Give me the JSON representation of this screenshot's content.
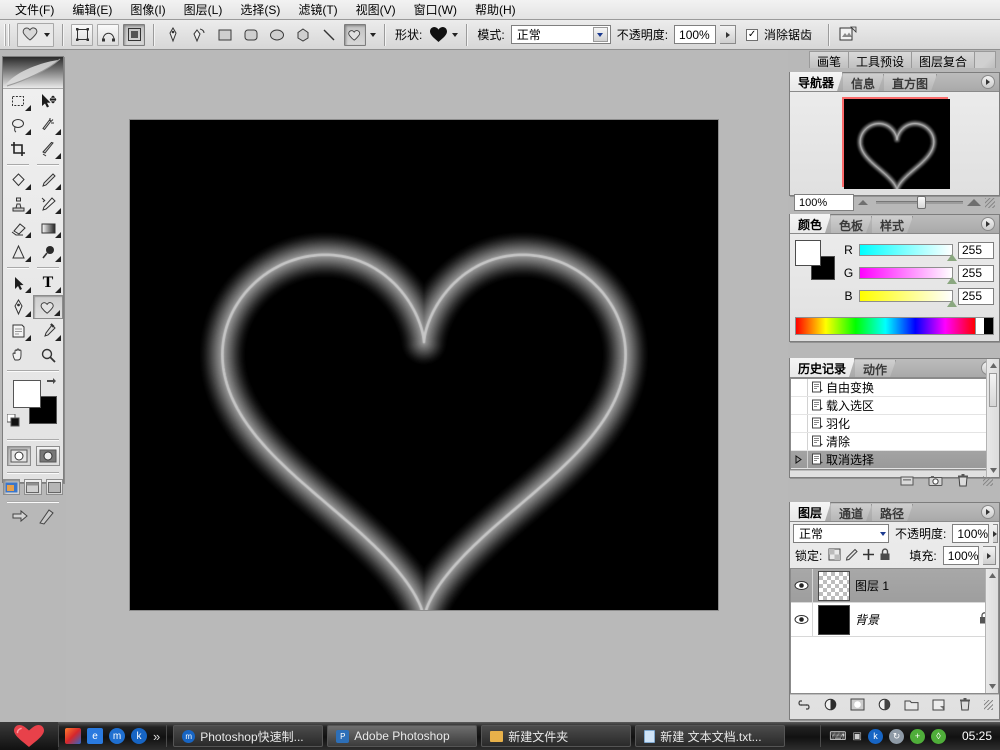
{
  "app": {
    "title": "Adobe Photoshop"
  },
  "menubar": {
    "items": [
      {
        "label": "文件(F)",
        "name": "menu-file"
      },
      {
        "label": "编辑(E)",
        "name": "menu-edit"
      },
      {
        "label": "图像(I)",
        "name": "menu-image"
      },
      {
        "label": "图层(L)",
        "name": "menu-layer"
      },
      {
        "label": "选择(S)",
        "name": "menu-select"
      },
      {
        "label": "滤镜(T)",
        "name": "menu-filter"
      },
      {
        "label": "视图(V)",
        "name": "menu-view"
      },
      {
        "label": "窗口(W)",
        "name": "menu-window"
      },
      {
        "label": "帮助(H)",
        "name": "menu-help"
      }
    ]
  },
  "options_bar": {
    "shape_label": "形状:",
    "shape_value": "heart-shape",
    "mode_label": "模式:",
    "mode_value": "正常",
    "opacity_label": "不透明度:",
    "opacity_value": "100%",
    "antialias_label": "消除锯齿",
    "antialias_checked": true,
    "shape_mode_buttons": [
      "shape-layers",
      "paths",
      "fill-pixels"
    ],
    "draw_tools": [
      "pen-tool",
      "freeform-pen-tool",
      "rectangle-tool",
      "rounded-rectangle-tool",
      "ellipse-tool",
      "polygon-tool",
      "line-tool",
      "custom-shape-tool"
    ]
  },
  "palette_well": {
    "tabs": [
      "画笔",
      "工具预设",
      "图层复合"
    ]
  },
  "toolbox": {
    "tools": [
      {
        "name": "rectangular-marquee-tool",
        "glyph": "▭"
      },
      {
        "name": "move-tool",
        "glyph": "➤"
      },
      {
        "name": "lasso-tool",
        "glyph": "◯"
      },
      {
        "name": "magic-wand-tool",
        "glyph": "✦"
      },
      {
        "name": "crop-tool",
        "glyph": "⌗"
      },
      {
        "name": "slice-tool",
        "glyph": "✂"
      },
      {
        "name": "healing-brush-tool",
        "glyph": "◇"
      },
      {
        "name": "brush-tool",
        "glyph": "✎"
      },
      {
        "name": "clone-stamp-tool",
        "glyph": "♙"
      },
      {
        "name": "history-brush-tool",
        "glyph": "↯"
      },
      {
        "name": "eraser-tool",
        "glyph": "▱"
      },
      {
        "name": "gradient-tool",
        "glyph": "▣"
      },
      {
        "name": "blur-tool",
        "glyph": "△"
      },
      {
        "name": "dodge-tool",
        "glyph": "●"
      },
      {
        "name": "path-selection-tool",
        "glyph": "▲"
      },
      {
        "name": "type-tool",
        "glyph": "T"
      },
      {
        "name": "pen-tool",
        "glyph": "✒"
      },
      {
        "name": "custom-shape-tool",
        "glyph": "✿"
      },
      {
        "name": "notes-tool",
        "glyph": "▤"
      },
      {
        "name": "eyedropper-tool",
        "glyph": "⌯"
      },
      {
        "name": "hand-tool",
        "glyph": "✋"
      },
      {
        "name": "zoom-tool",
        "glyph": "🔍"
      }
    ],
    "selected_tool": "custom-shape-tool",
    "foreground_color": "#ffffff",
    "background_color": "#000000",
    "quickmask": [
      "standard-mode",
      "quick-mask-mode"
    ],
    "screen_modes": [
      "standard-screen-mode",
      "full-screen-with-menubar",
      "full-screen-mode"
    ],
    "jump_to": "jump-to-imageready"
  },
  "navigator": {
    "tabs": [
      "导航器",
      "信息",
      "直方图"
    ],
    "active_tab": "导航器",
    "zoom_value": "100%"
  },
  "color": {
    "tabs": [
      "颜色",
      "色板",
      "样式"
    ],
    "active_tab": "颜色",
    "channels": [
      {
        "label": "R",
        "value": "255"
      },
      {
        "label": "G",
        "value": "255"
      },
      {
        "label": "B",
        "value": "255"
      }
    ],
    "foreground": "#ffffff",
    "background": "#000000"
  },
  "history": {
    "tabs": [
      "历史记录",
      "动作"
    ],
    "active_tab": "历史记录",
    "items": [
      {
        "label": "自由变换",
        "selected": false
      },
      {
        "label": "载入选区",
        "selected": false
      },
      {
        "label": "羽化",
        "selected": false
      },
      {
        "label": "清除",
        "selected": false
      },
      {
        "label": "取消选择",
        "selected": true
      }
    ],
    "footer_buttons": [
      "new-document-from-state-icon",
      "new-snapshot-icon",
      "delete-state-icon"
    ]
  },
  "layers": {
    "tabs": [
      "图层",
      "通道",
      "路径"
    ],
    "active_tab": "图层",
    "blend_mode": "正常",
    "opacity_label": "不透明度:",
    "opacity_value": "100%",
    "lock_label": "锁定:",
    "lock_icons": [
      "lock-transparent-pixels-icon",
      "lock-image-pixels-icon",
      "lock-position-icon",
      "lock-all-icon"
    ],
    "fill_label": "填充:",
    "fill_value": "100%",
    "items": [
      {
        "name": "图层 1",
        "selected": true,
        "visible": true,
        "locked": false,
        "thumb": "transparent"
      },
      {
        "name": "背景",
        "selected": false,
        "visible": true,
        "locked": true,
        "thumb": "black"
      }
    ],
    "footer_buttons": [
      "link-layers-icon",
      "layer-style-icon",
      "layer-mask-icon",
      "adjustment-layer-icon",
      "new-group-icon",
      "new-layer-icon",
      "delete-layer-icon"
    ]
  },
  "document": {
    "background_color": "#000000",
    "artwork": "glowing-heart-outline",
    "glow_color": "#ffffff"
  },
  "taskbar": {
    "start_label": "heart-start-button",
    "quick_launch": [
      "show-desktop-icon",
      "ie-icon",
      "messenger-icon",
      "kugou-icon"
    ],
    "overflow_label": "»",
    "tasks": [
      {
        "label": "Photoshop快速制...",
        "icon": "media-icon",
        "active": false
      },
      {
        "label": "Adobe Photoshop",
        "icon": "photoshop-icon",
        "active": true
      },
      {
        "label": "新建文件夹",
        "icon": "folder-icon",
        "active": false
      },
      {
        "label": "新建 文本文档.txt...",
        "icon": "notepad-icon",
        "active": false
      }
    ],
    "tray_icons": [
      "keyboard-icon",
      "network-icon",
      "kugou-tray-icon",
      "update-icon",
      "antivirus-icon",
      "shield-icon"
    ],
    "clock": "05:25"
  }
}
